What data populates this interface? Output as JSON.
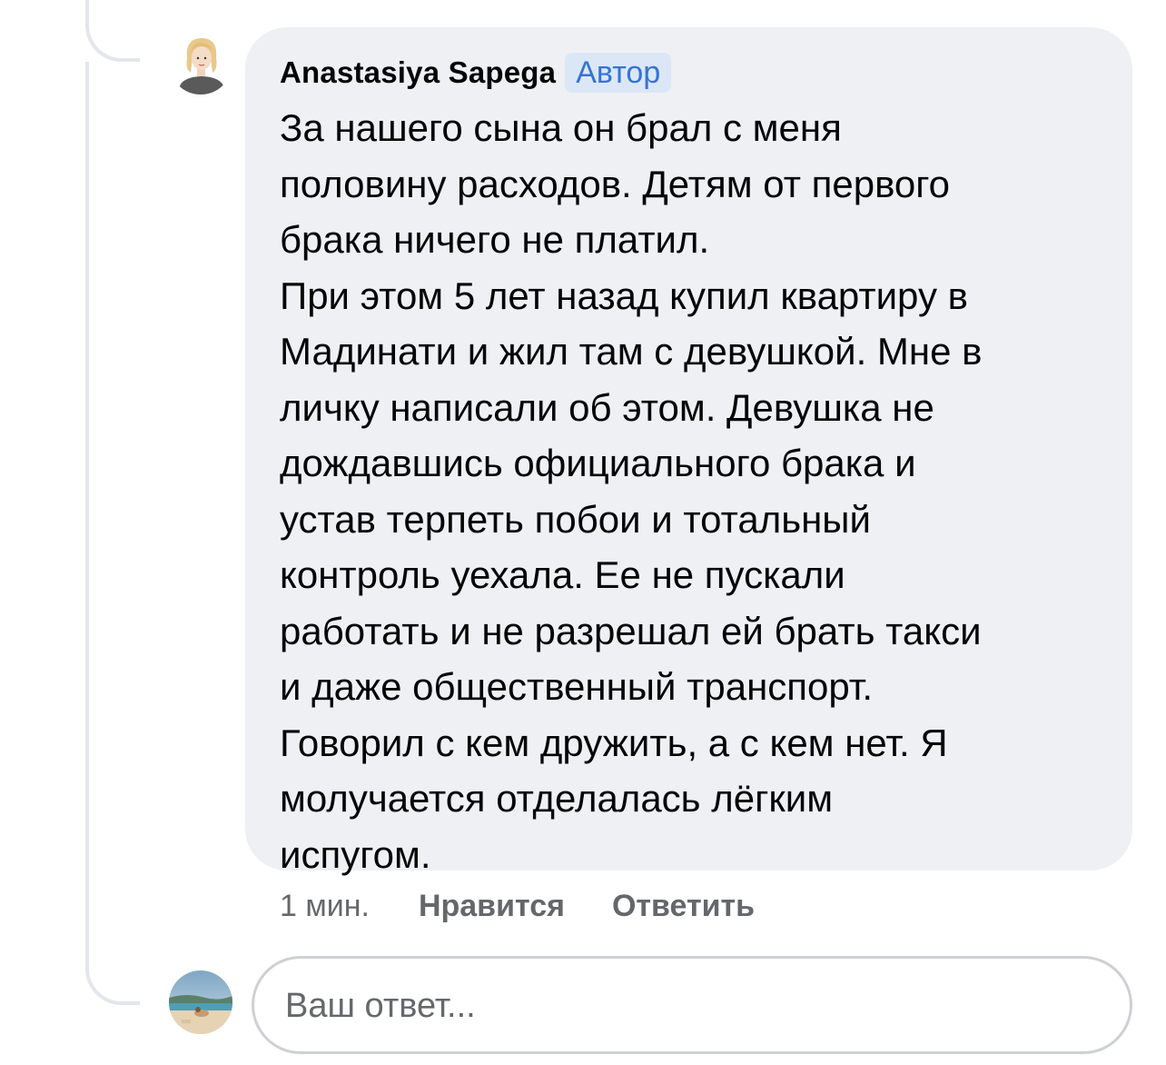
{
  "comment": {
    "author": "Anastasiya Sapega",
    "badge": "Автор",
    "text": "За нашего сына он брал с меня\nполовину расходов. Детям от первого\nбрака ничего не платил.\nПри этом 5 лет назад купил квартиру в\nМадинати и жил там с девушкой. Мне в\nличку написали об этом. Девушка не\nдождавшись официального брака и\nустав терпеть побои и тотальный\nконтроль уехала. Ее не пускали\nработать и не разрешал ей брать такси\nи даже общественный транспорт.\nГоворил с кем дружить, а с кем нет. Я\nмолучается отделалась лёгким\nиспугом.",
    "time": "1 мин.",
    "like_label": "Нравится",
    "reply_label": "Ответить",
    "author_avatar_icon": "user-avatar-illustrated-woman",
    "colors": {
      "bubble": "#eff0f4",
      "badge_bg": "#dbe7f6",
      "badge_text": "#3573d6",
      "meta_text": "#65676b"
    }
  },
  "reply": {
    "placeholder": "Ваш ответ...",
    "avatar_icon": "user-avatar-beach-photo"
  }
}
